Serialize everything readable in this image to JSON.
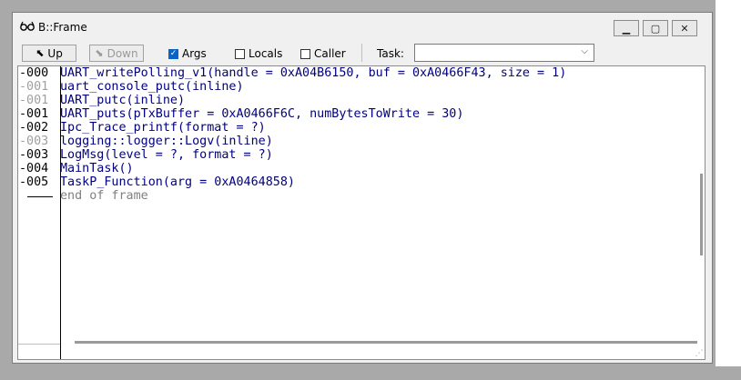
{
  "window": {
    "title": "B::Frame",
    "icon": "glasses-icon"
  },
  "toolbar": {
    "up_label": "Up",
    "down_label": "Down",
    "args_label": "Args",
    "args_checked": true,
    "locals_label": "Locals",
    "locals_checked": false,
    "caller_label": "Caller",
    "caller_checked": false,
    "task_label": "Task:",
    "task_value": ""
  },
  "frames": [
    {
      "level": "-000",
      "text": "UART_writePolling_v1(handle = 0xA04B6150, buf = 0xA0466F43, size = 1)",
      "inline": false
    },
    {
      "level": "-001",
      "text": "uart_console_putc(inline)",
      "inline": true
    },
    {
      "level": "-001",
      "text": "UART_putc(inline)",
      "inline": true
    },
    {
      "level": "-001",
      "text": "UART_puts(pTxBuffer = 0xA0466F6C, numBytesToWrite = 30)",
      "inline": false
    },
    {
      "level": "-002",
      "text": "Ipc_Trace_printf(format = ?)",
      "inline": false
    },
    {
      "level": "-003",
      "text": "logging::logger::Logv(inline)",
      "inline": true
    },
    {
      "level": "-003",
      "text": "LogMsg(level = ?, format = ?)",
      "inline": false
    },
    {
      "level": "-004",
      "text": "MainTask()",
      "inline": false
    },
    {
      "level": "-005",
      "text": "TaskP_Function(arg = 0xA0464858)",
      "inline": false
    },
    {
      "level": "----",
      "text": "end of frame",
      "inline": true
    }
  ]
}
